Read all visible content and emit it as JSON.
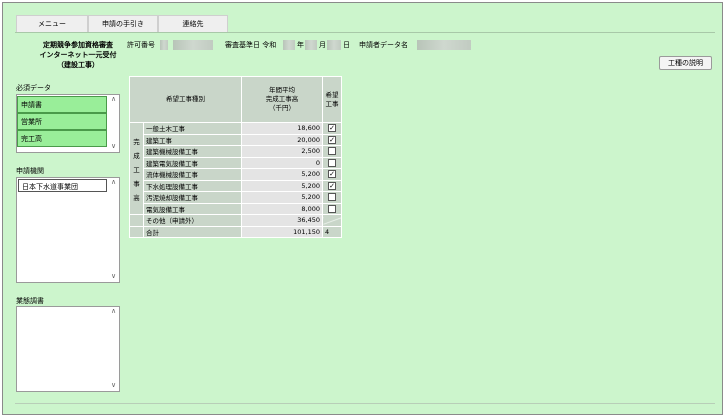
{
  "tabs": [
    {
      "label": "メニュー"
    },
    {
      "label": "申請の手引き"
    },
    {
      "label": "連絡先"
    }
  ],
  "header": {
    "title_line1": "定期競争参加資格審査",
    "title_line2": "インターネット一元受付",
    "title_line3": "（建設工事）",
    "permit_label": "許可番号",
    "review_date_label": "審査基準日 令和",
    "year_unit": "年",
    "month_unit": "月",
    "day_unit": "日",
    "applicant_data_label": "申請者データ名"
  },
  "construction_button": "工種の説明",
  "required": {
    "label": "必須データ",
    "items": [
      "申請書",
      "営業所",
      "完工高"
    ]
  },
  "agency": {
    "label": "申請機関",
    "items": [
      "日本下水道事業団"
    ]
  },
  "survey": {
    "label": "業態調書"
  },
  "table": {
    "col_type": "希望工事種別",
    "col_amount_1": "年間平均",
    "col_amount_2": "完成工事高",
    "col_amount_3": "（千円）",
    "col_wish_1": "希望",
    "col_wish_2": "工事",
    "side_label": [
      "完",
      "成",
      "工",
      "事",
      "高"
    ],
    "rows": [
      {
        "name": "一般土木工事",
        "amount": "18,600",
        "checked": true
      },
      {
        "name": "建築工事",
        "amount": "20,000",
        "checked": true
      },
      {
        "name": "建築機械設備工事",
        "amount": "2,500",
        "checked": false
      },
      {
        "name": "建築電気設備工事",
        "amount": "0",
        "checked": false
      },
      {
        "name": "流体機械設備工事",
        "amount": "5,200",
        "checked": true
      },
      {
        "name": "下水処理設備工事",
        "amount": "5,200",
        "checked": true
      },
      {
        "name": "汚泥焼却設備工事",
        "amount": "5,200",
        "checked": false
      },
      {
        "name": "電気設備工事",
        "amount": "8,000",
        "checked": false
      }
    ],
    "other_label": "その他（申請外）",
    "other_amount": "36,450",
    "total_label": "合計",
    "total_amount": "101,150",
    "total_count": "4"
  },
  "colors": {
    "page_bg": "#ccf5cc",
    "required_item_bg": "#99ee99",
    "table_header_bg": "#c9d6c9"
  }
}
